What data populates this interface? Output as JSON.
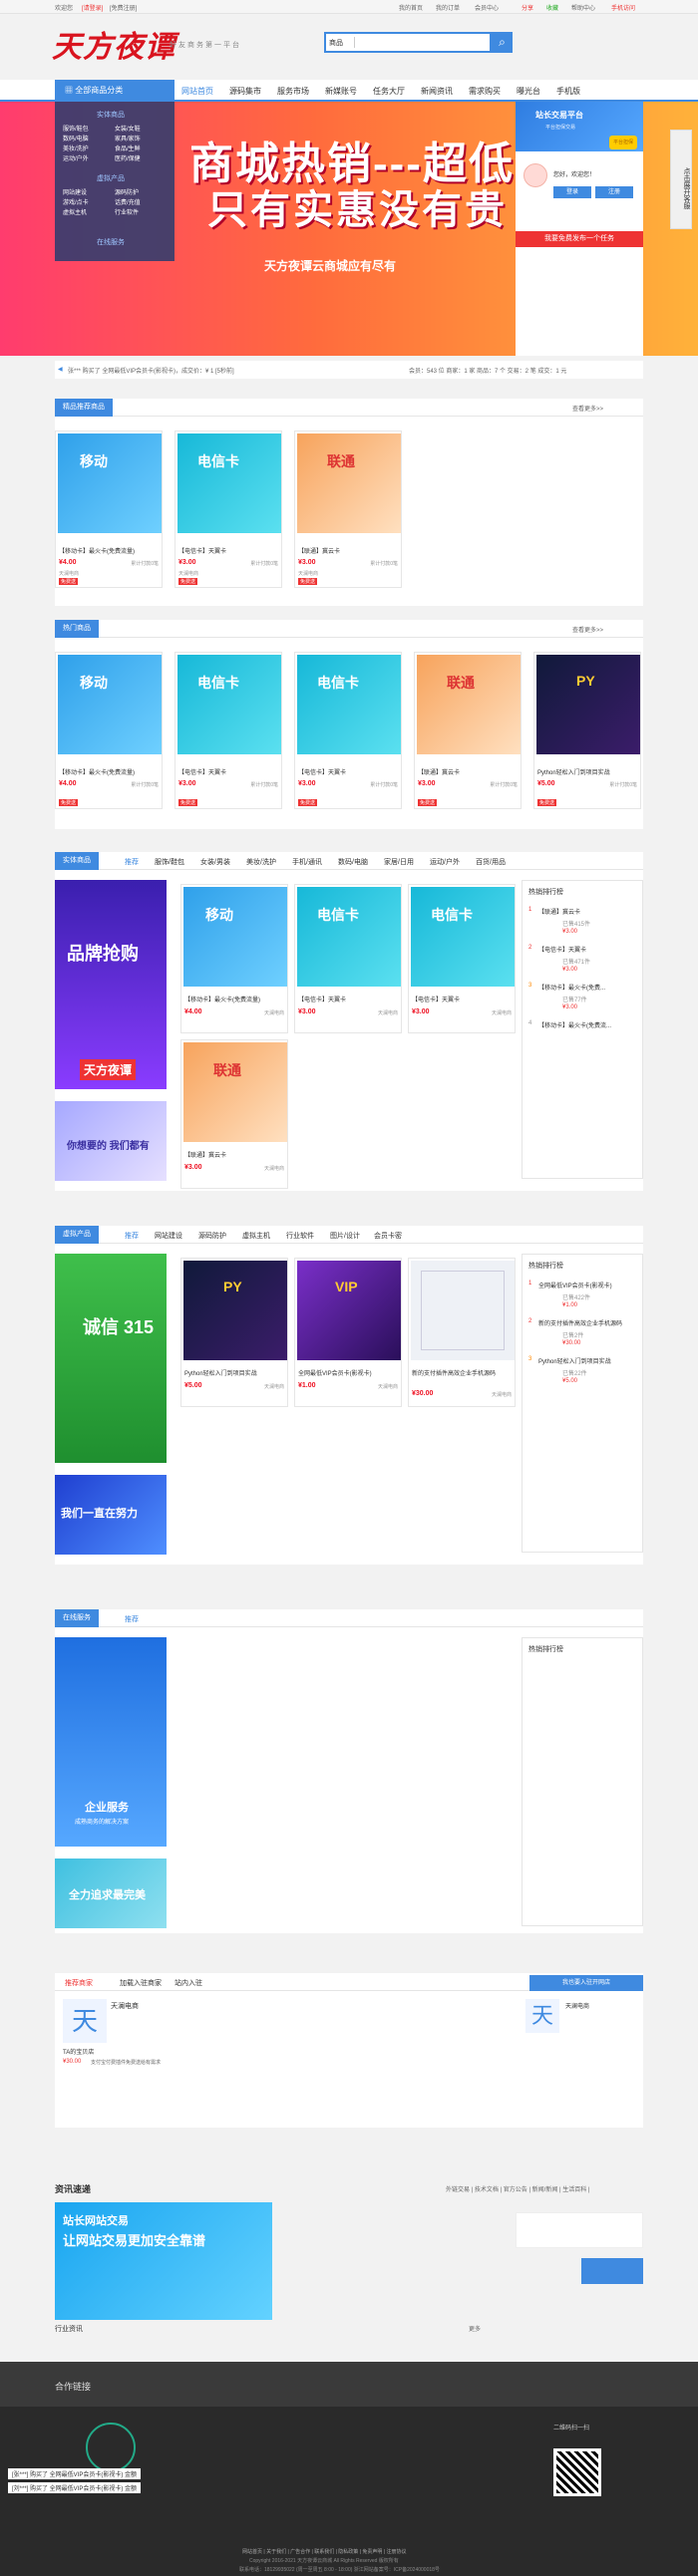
{
  "topbar": {
    "welcome": "欢迎您",
    "login": "[请登录]",
    "register": "[免费注册]",
    "links": [
      "我的首页",
      "我的订单",
      "会员中心",
      "分享",
      "收藏",
      "帮助中心",
      "手机访问"
    ]
  },
  "header": {
    "logo": "天方夜谭",
    "slogan": "好友商务第一平台",
    "search_category": "商品",
    "search_placeholder": ""
  },
  "nav": {
    "category_label": "全部商品分类",
    "items": [
      "网站首页",
      "源码集市",
      "服务市场",
      "新媒账号",
      "任务大厅",
      "新闻资讯",
      "需求购买",
      "曝光台",
      "手机版"
    ]
  },
  "side_menu": {
    "g1": "实体商品",
    "g1_items": [
      "服饰/鞋包",
      "女装/女鞋",
      "数码/电脑",
      "家具/家饰",
      "美妆/洗护",
      "食品/生鲜",
      "运动/户外",
      "医药/保健"
    ],
    "g2": "虚拟产品",
    "g2_items": [
      "网站建设",
      "源码防护",
      "游戏/点卡",
      "话费/充值",
      "虚拟主机",
      "行业软件",
      "图片/设计",
      "会员卡密"
    ],
    "g3": "在线服务"
  },
  "banner": {
    "title1": "商城热销---超低价",
    "title2": "只有实惠没有贵",
    "tagline": "天方夜谭云商城应有尽有"
  },
  "login_box": {
    "title": "站长交易平台",
    "subtitle": "平台担保交易",
    "badge": "平台担保",
    "hello": "您好，欢迎您！",
    "login_btn": "登录",
    "register_btn": "注册",
    "open_shop": "我要免费发布一个任务"
  },
  "float_tab": "点击展开客服",
  "ticker": {
    "text": "张***  购买了  全网最低VIP会员卡(影视卡)，成交价：¥ 1 [5秒前]",
    "stats": "会员：543 位    商家：1 家    商品：7 个    交易：2 笔    成交：1 元"
  },
  "sections": {
    "recommend": {
      "title": "精品推荐商品",
      "more": "查看更多>>"
    },
    "hot": {
      "title": "热门商品",
      "more": "查看更多>>"
    },
    "physical": {
      "title": "实体商品",
      "tabs": [
        "推荐",
        "服饰/鞋包",
        "女装/男装",
        "美妆/洗护",
        "手机/通讯",
        "数码/电脑",
        "家居/日用",
        "运动/户外",
        "百货/用品"
      ]
    },
    "virtual": {
      "title": "虚拟产品",
      "tabs": [
        "推荐",
        "网站建设",
        "源码防护",
        "虚拟主机",
        "行业软件",
        "图片/设计",
        "会员卡密"
      ]
    },
    "service": {
      "title": "在线服务",
      "tabs": [
        "推荐"
      ]
    },
    "rank_title": "热销排行榜"
  },
  "products": {
    "mobile": {
      "name": "【移动卡】最火卡(免费流量)",
      "price": "¥4.00",
      "sold": "累计付款0笔",
      "shop": "天澜电商",
      "tag": "免费送"
    },
    "telecom": {
      "name": "【电信卡】天翼卡",
      "price": "¥3.00",
      "sold": "累计付款0笔",
      "shop": "天澜电商",
      "tag": "免费送"
    },
    "unicom": {
      "name": "【联通】冀云卡",
      "price": "¥3.00",
      "sold": "累计付款0笔",
      "shop": "天澜电商",
      "tag": "免费送"
    },
    "python": {
      "name": "Python轻松入门到项目实战",
      "price": "¥5.00",
      "sold": "累计付款0笔",
      "shop": "天澜电商",
      "tag": "免费送"
    },
    "vip": {
      "name": "全网最低VIP会员卡(影视卡)",
      "price": "¥1.00",
      "sold": "天澜电商"
    },
    "source": {
      "name": "新的支付插件高效企业手机源码",
      "price": "¥30.00",
      "sold": "天澜电商"
    }
  },
  "rank_physical": [
    {
      "name": "【联通】冀云卡",
      "count": "已售415件",
      "price": "¥3.00"
    },
    {
      "name": "【电信卡】天翼卡",
      "count": "已售471件",
      "price": "¥3.00"
    },
    {
      "name": "【移动卡】最火卡(免费...",
      "count": "已售77件",
      "price": "¥3.00"
    },
    {
      "name": "【移动卡】最火卡(免费流...",
      "count": "",
      "price": ""
    }
  ],
  "rank_virtual": [
    {
      "name": "全网最低VIP会员卡(影视卡)",
      "count": "已售422件",
      "price": "¥1.00"
    },
    {
      "name": "新的支付插件高效企业手机源码",
      "count": "已售2件",
      "price": "¥30.00"
    },
    {
      "name": "Python轻松入门到项目实战",
      "count": "已售22件",
      "price": "¥5.00"
    }
  ],
  "promos": {
    "physical_1": "品牌抢购",
    "physical_2": "天方夜谭",
    "physical_3": "你想要的 我们都有",
    "virtual_1": "诚信 315",
    "virtual_2": "我们一直在努力",
    "service_1": "企业服务",
    "service_1_sub": "成熟商务的解决方案",
    "service_2": "全力追求最完美"
  },
  "shop_box": {
    "tabs": [
      "推荐商家",
      "加载入驻商家",
      "站内入驻"
    ],
    "btn": "我也要入驻开网店",
    "shop_name": "天澜电商",
    "shop_desc": "TA的宝贝店",
    "shop_price": "¥30.00",
    "shop_item": "支付宝付费插件免费送给有需求"
  },
  "news": {
    "title": "资讯速递",
    "links": "外链交易 | 技术文档 | 官方公告 | 新闻/新闻 | 生活百科 |",
    "banner_top": "站长网站交易",
    "banner_mid": "让网站交易更加安全靠谱",
    "sub": "行业资讯",
    "more": "更多"
  },
  "footer": {
    "partners": "合作链接",
    "qr_label": "二维码扫一扫",
    "links": "网站首页 | 关于我们 | 广告合作 | 联系我们 | 隐私政策 | 免责声明 | 注册协议",
    "copyright": "Copyright 2016-2021 天方夜谭云商城 All Rights Reserved 版权所有",
    "icp": "联系电话：18129935022 (周一至周五 8:00 - 18:00)  浙江网站备案号：ICP备2024000018号",
    "ticker1": "[张***] 购买了 全网最低VIP会员卡(影视卡) 金额",
    "ticker2": "[刘***] 购买了 全网最低VIP会员卡(影视卡) 金额"
  },
  "colors": {
    "brand_blue": "#3f8ae0",
    "price_red": "#ee1122",
    "logo_red": "#d9141f"
  }
}
